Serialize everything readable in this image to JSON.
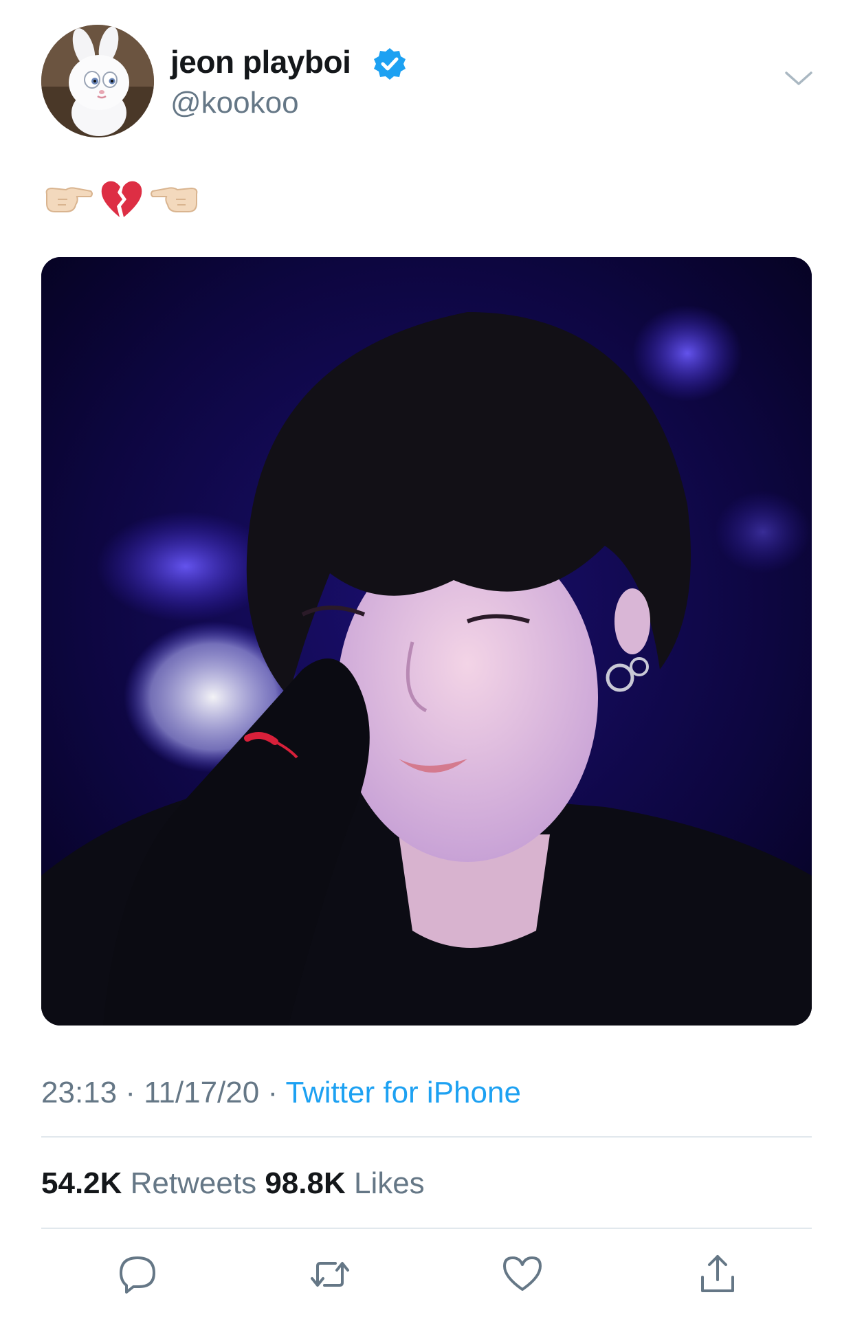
{
  "author": {
    "display_name": "jeon playboi",
    "handle": "@kookoo",
    "verified": true,
    "avatar_icon": "snowball-bunny-avatar"
  },
  "tweet": {
    "emoji": [
      "pointing-right-hand",
      "broken-heart",
      "pointing-left-hand"
    ],
    "media_icon": "tweet-photo-person-in-black-hoodie-blue-background"
  },
  "meta": {
    "time": "23:13",
    "date": "11/17/20",
    "separator": " · ",
    "source": "Twitter for iPhone"
  },
  "stats": {
    "retweets_count": "54.2K",
    "retweets_label": "Retweets",
    "likes_count": "98.8K",
    "likes_label": "Likes"
  },
  "actions": {
    "reply_icon": "reply-icon",
    "retweet_icon": "retweet-icon",
    "like_icon": "heart-icon",
    "share_icon": "share-icon"
  },
  "colors": {
    "accent": "#1da1f2",
    "text": "#14171a",
    "muted": "#657786",
    "divider": "#e1e8ed",
    "icon": "#657786"
  }
}
